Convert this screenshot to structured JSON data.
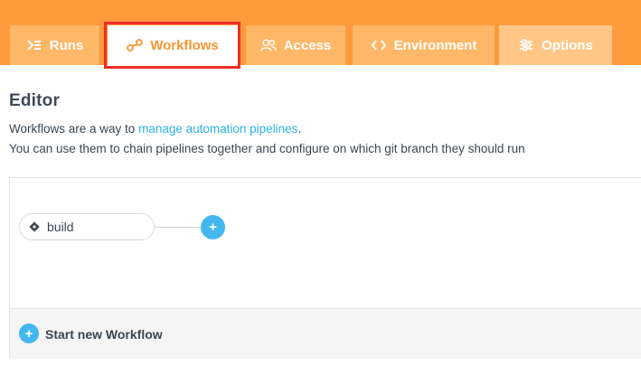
{
  "tabs": [
    {
      "label": "Runs",
      "icon": "runs-icon"
    },
    {
      "label": "Workflows",
      "icon": "workflows-icon",
      "active": true
    },
    {
      "label": "Access",
      "icon": "access-icon"
    },
    {
      "label": "Environment",
      "icon": "code-icon"
    },
    {
      "label": "Options",
      "icon": "options-icon"
    }
  ],
  "editor": {
    "title": "Editor",
    "desc_prefix": "Workflows are a way to ",
    "desc_link": "manage automation pipelines",
    "desc_suffix": ".",
    "desc_line2": "You can use them to chain pipelines together and configure on which git branch they should run"
  },
  "workflow": {
    "node_label": "build",
    "add_pipeline_symbol": "+",
    "start_symbol": "+",
    "start_label": "Start new Workflow"
  },
  "colors": {
    "topbar": "#ff9a3c",
    "tab": "#ffb768",
    "active_text": "#f7962f",
    "link": "#2db3e3",
    "plus": "#44b8ee",
    "highlight": "#ee2b23"
  }
}
